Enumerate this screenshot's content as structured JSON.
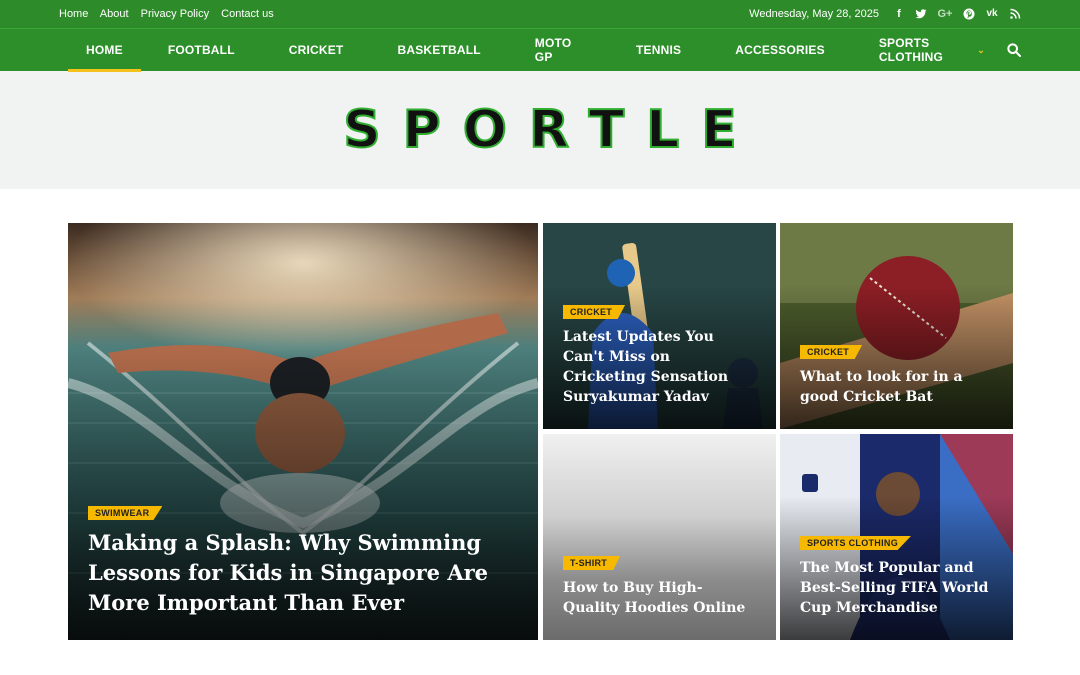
{
  "topbar": {
    "links": [
      "Home",
      "About",
      "Privacy Policy",
      "Contact us"
    ],
    "date": "Wednesday, May 28, 2025",
    "social_icons": [
      "facebook-icon",
      "twitter-icon",
      "google-plus-icon",
      "pinterest-icon",
      "vk-icon",
      "rss-icon"
    ]
  },
  "nav": {
    "items": [
      "HOME",
      "FOOTBALL",
      "CRICKET",
      "BASKETBALL",
      "MOTO GP",
      "TENNIS",
      "ACCESSORIES",
      "SPORTS CLOTHING"
    ],
    "active_index": 0,
    "search_icon": "search-icon"
  },
  "brand": {
    "logo": "SPORTLE"
  },
  "colors": {
    "primary_green": "#2d8f2a",
    "accent_yellow": "#f7b900",
    "masthead_bg": "#f1f2f2"
  },
  "featured": [
    {
      "tag": "SWIMWEAR",
      "title": "Making a Splash: Why Swimming Lessons for Kids in Singapore Are More Important Than Ever"
    },
    {
      "tag": "CRICKET",
      "title": "Latest Updates You Can't Miss on Cricketing Sensation Suryakumar Yadav"
    },
    {
      "tag": "CRICKET",
      "title": "What to look for in a good Cricket Bat"
    },
    {
      "tag": "T-SHIRT",
      "title": "How to Buy High-Quality Hoodies Online"
    },
    {
      "tag": "SPORTS CLOTHING",
      "title": "The Most Popular and Best-Selling FIFA World Cup Merchandise"
    }
  ]
}
